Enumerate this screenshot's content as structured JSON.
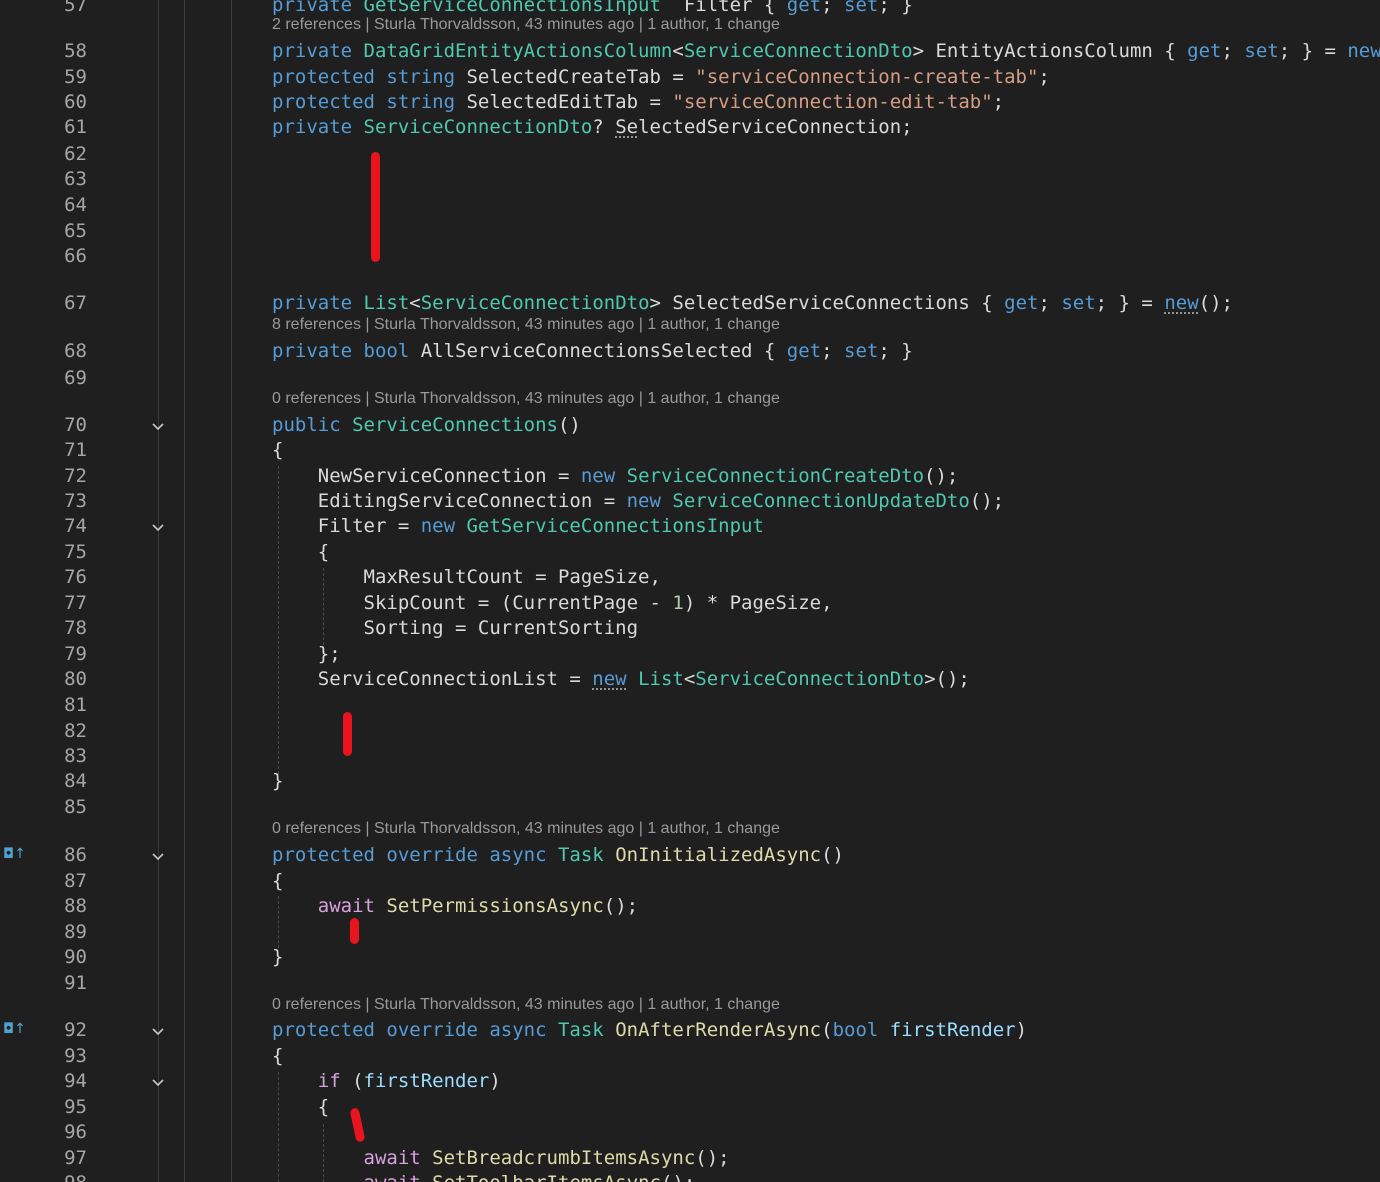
{
  "colors": {
    "background": "#1f1f1f",
    "keyword": "#569cd6",
    "type": "#4ec9b0",
    "string": "#d69d85",
    "method": "#dcdcaa",
    "control": "#d8a0df",
    "parameter": "#9cdcfe",
    "number": "#b5cea8",
    "lens": "#9a9a9a",
    "line_number": "#a6a6a6",
    "annotation": "#e8141e"
  },
  "gutter": {
    "override_icon": "◘↑"
  },
  "lines": [
    {
      "no": "57",
      "tokens": [
        [
          "kw",
          "private "
        ],
        [
          "ty",
          "GetServiceConnectionsInput"
        ],
        [
          "",
          "  Filter { "
        ],
        [
          "kw",
          "get"
        ],
        [
          "",
          "; "
        ],
        [
          "kw",
          "set"
        ],
        [
          "",
          "; }"
        ]
      ]
    },
    {
      "no": "58",
      "tokens": [
        [
          "kw",
          "private "
        ],
        [
          "ty",
          "DataGridEntityActionsColumn"
        ],
        [
          "",
          "<"
        ],
        [
          "ty",
          "ServiceConnectionDto"
        ],
        [
          "",
          "> EntityActionsColumn { "
        ],
        [
          "kw",
          "get"
        ],
        [
          "",
          "; "
        ],
        [
          "kw",
          "set"
        ],
        [
          "",
          "; } = "
        ],
        [
          "kw",
          "new"
        ]
      ]
    },
    {
      "no": "59",
      "tokens": [
        [
          "kw",
          "protected "
        ],
        [
          "kw",
          "string"
        ],
        [
          "",
          " SelectedCreateTab = "
        ],
        [
          "st",
          "\"serviceConnection-create-tab\""
        ],
        [
          "",
          ";"
        ]
      ]
    },
    {
      "no": "60",
      "tokens": [
        [
          "kw",
          "protected "
        ],
        [
          "kw",
          "string"
        ],
        [
          "",
          " SelectedEditTab = "
        ],
        [
          "st",
          "\"serviceConnection-edit-tab\""
        ],
        [
          "",
          ";"
        ]
      ]
    },
    {
      "no": "61",
      "tokens": [
        [
          "kw",
          "private "
        ],
        [
          "ty",
          "ServiceConnectionDto"
        ],
        [
          "",
          "? "
        ],
        [
          "dots",
          "Se"
        ],
        [
          "",
          "lectedServiceConnection;"
        ]
      ]
    },
    {
      "no": "62",
      "tokens": []
    },
    {
      "no": "63",
      "tokens": []
    },
    {
      "no": "64",
      "tokens": []
    },
    {
      "no": "65",
      "tokens": []
    },
    {
      "no": "66",
      "tokens": []
    },
    {
      "no": "67",
      "tokens": [
        [
          "kw",
          "private "
        ],
        [
          "ty",
          "List"
        ],
        [
          "",
          "<"
        ],
        [
          "ty",
          "ServiceConnectionDto"
        ],
        [
          "",
          "> SelectedServiceConnections { "
        ],
        [
          "kw",
          "get"
        ],
        [
          "",
          "; "
        ],
        [
          "kw",
          "set"
        ],
        [
          "",
          "; } = "
        ],
        [
          "kwdots",
          "new"
        ],
        [
          "",
          "();"
        ]
      ]
    },
    {
      "no": "68",
      "tokens": [
        [
          "kw",
          "private "
        ],
        [
          "kw",
          "bool"
        ],
        [
          "",
          " AllServiceConnectionsSelected { "
        ],
        [
          "kw",
          "get"
        ],
        [
          "",
          "; "
        ],
        [
          "kw",
          "set"
        ],
        [
          "",
          "; }"
        ]
      ]
    },
    {
      "no": "69",
      "tokens": []
    },
    {
      "no": "70",
      "tokens": [
        [
          "kw",
          "public "
        ],
        [
          "ty",
          "ServiceConnections"
        ],
        [
          "",
          "()"
        ]
      ]
    },
    {
      "no": "71",
      "tokens": [
        [
          "",
          "{"
        ]
      ]
    },
    {
      "no": "72",
      "tokens": [
        [
          "",
          "    NewServiceConnection = "
        ],
        [
          "kw",
          "new "
        ],
        [
          "ty",
          "ServiceConnectionCreateDto"
        ],
        [
          "",
          "();"
        ]
      ]
    },
    {
      "no": "73",
      "tokens": [
        [
          "",
          "    EditingServiceConnection = "
        ],
        [
          "kw",
          "new "
        ],
        [
          "ty",
          "ServiceConnectionUpdateDto"
        ],
        [
          "",
          "();"
        ]
      ]
    },
    {
      "no": "74",
      "tokens": [
        [
          "",
          "    Filter = "
        ],
        [
          "kw",
          "new "
        ],
        [
          "ty",
          "GetServiceConnectionsInput"
        ]
      ]
    },
    {
      "no": "75",
      "tokens": [
        [
          "",
          "    {"
        ]
      ]
    },
    {
      "no": "76",
      "tokens": [
        [
          "",
          "        MaxResultCount = PageSize,"
        ]
      ]
    },
    {
      "no": "77",
      "tokens": [
        [
          "",
          "        SkipCount = (CurrentPage - "
        ],
        [
          "nu",
          "1"
        ],
        [
          "",
          ") * PageSize,"
        ]
      ]
    },
    {
      "no": "78",
      "tokens": [
        [
          "",
          "        Sorting = CurrentSorting"
        ]
      ]
    },
    {
      "no": "79",
      "tokens": [
        [
          "",
          "    };"
        ]
      ]
    },
    {
      "no": "80",
      "tokens": [
        [
          "",
          "    ServiceConnectionList = "
        ],
        [
          "kwdots",
          "new"
        ],
        [
          "",
          " "
        ],
        [
          "ty",
          "List"
        ],
        [
          "",
          "<"
        ],
        [
          "ty",
          "ServiceConnectionDto"
        ],
        [
          "",
          ">();"
        ]
      ]
    },
    {
      "no": "81",
      "tokens": []
    },
    {
      "no": "82",
      "tokens": []
    },
    {
      "no": "83",
      "tokens": []
    },
    {
      "no": "84",
      "tokens": [
        [
          "",
          "}"
        ]
      ]
    },
    {
      "no": "85",
      "tokens": []
    },
    {
      "no": "86",
      "tokens": [
        [
          "kw",
          "protected "
        ],
        [
          "kw",
          "override "
        ],
        [
          "kw",
          "async "
        ],
        [
          "ty",
          "Task"
        ],
        [
          "",
          " "
        ],
        [
          "me",
          "OnInitializedAsync"
        ],
        [
          "",
          "()"
        ]
      ]
    },
    {
      "no": "87",
      "tokens": [
        [
          "",
          "{"
        ]
      ]
    },
    {
      "no": "88",
      "tokens": [
        [
          "",
          "    "
        ],
        [
          "fl",
          "await"
        ],
        [
          "",
          " "
        ],
        [
          "me",
          "SetPermissionsAsync"
        ],
        [
          "",
          "();"
        ]
      ]
    },
    {
      "no": "89",
      "tokens": []
    },
    {
      "no": "90",
      "tokens": [
        [
          "",
          "}"
        ]
      ]
    },
    {
      "no": "91",
      "tokens": []
    },
    {
      "no": "92",
      "tokens": [
        [
          "kw",
          "protected "
        ],
        [
          "kw",
          "override "
        ],
        [
          "kw",
          "async "
        ],
        [
          "ty",
          "Task"
        ],
        [
          "",
          " "
        ],
        [
          "me",
          "OnAfterRenderAsync"
        ],
        [
          "",
          "("
        ],
        [
          "kw",
          "bool"
        ],
        [
          "",
          " "
        ],
        [
          "pa",
          "firstRender"
        ],
        [
          "",
          ")"
        ]
      ]
    },
    {
      "no": "93",
      "tokens": [
        [
          "",
          "{"
        ]
      ]
    },
    {
      "no": "94",
      "tokens": [
        [
          "",
          "    "
        ],
        [
          "fl",
          "if"
        ],
        [
          "",
          " ("
        ],
        [
          "pa",
          "firstRender"
        ],
        [
          "",
          ")"
        ]
      ]
    },
    {
      "no": "95",
      "tokens": [
        [
          "",
          "    {"
        ]
      ]
    },
    {
      "no": "96",
      "tokens": []
    },
    {
      "no": "97",
      "tokens": [
        [
          "",
          "        "
        ],
        [
          "fl",
          "await"
        ],
        [
          "",
          " "
        ],
        [
          "me",
          "SetBreadcrumbItemsAsync"
        ],
        [
          "",
          "();"
        ]
      ]
    },
    {
      "no": "98",
      "tokens": [
        [
          "",
          "        "
        ],
        [
          "fl",
          "await"
        ],
        [
          "",
          " "
        ],
        [
          "me",
          "SetToolbarItemsAsync"
        ],
        [
          "",
          "();"
        ]
      ]
    }
  ],
  "lens": {
    "l58": "2 references | Sturla Thorvaldsson, 43 minutes ago | 1 author, 1 change",
    "l68": "8 references | Sturla Thorvaldsson, 43 minutes ago | 1 author, 1 change",
    "l70": "0 references | Sturla Thorvaldsson, 43 minutes ago | 1 author, 1 change",
    "l86": "0 references | Sturla Thorvaldsson, 43 minutes ago | 1 author, 1 change",
    "l92": "0 references | Sturla Thorvaldsson, 43 minutes ago | 1 author, 1 change"
  }
}
